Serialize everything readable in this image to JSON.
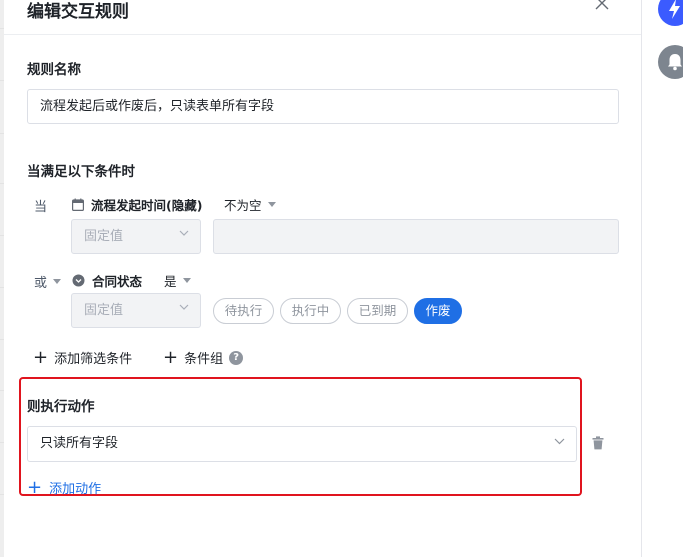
{
  "modal": {
    "title": "编辑交互规则",
    "close_icon": "close-icon"
  },
  "rule_name": {
    "label": "规则名称",
    "value": "流程发起后或作废后，只读表单所有字段"
  },
  "conditions": {
    "label": "当满足以下条件时",
    "rows": [
      {
        "prefix": "当",
        "field_icon": "calendar-icon",
        "field_name": "流程发起时间(隐藏)",
        "operator": "不为空",
        "value_type": "固定值",
        "value": ""
      },
      {
        "prefix": "或",
        "field_icon": "dropdown-field-icon",
        "field_name": "合同状态",
        "operator": "是",
        "value_type": "固定值",
        "options": [
          {
            "label": "待执行",
            "selected": false
          },
          {
            "label": "执行中",
            "selected": false
          },
          {
            "label": "已到期",
            "selected": false
          },
          {
            "label": "作废",
            "selected": true
          }
        ]
      }
    ],
    "add_filter_label": "添加筛选条件",
    "add_group_label": "条件组"
  },
  "actions": {
    "label": "则执行动作",
    "selected_action": "只读所有字段",
    "add_action_label": "添加动作"
  },
  "colors": {
    "accent": "#1f6fe5",
    "highlight_border": "#e0141e",
    "rail_icon_blue": "#3b5bff",
    "rail_icon_gray": "#7d858f"
  }
}
